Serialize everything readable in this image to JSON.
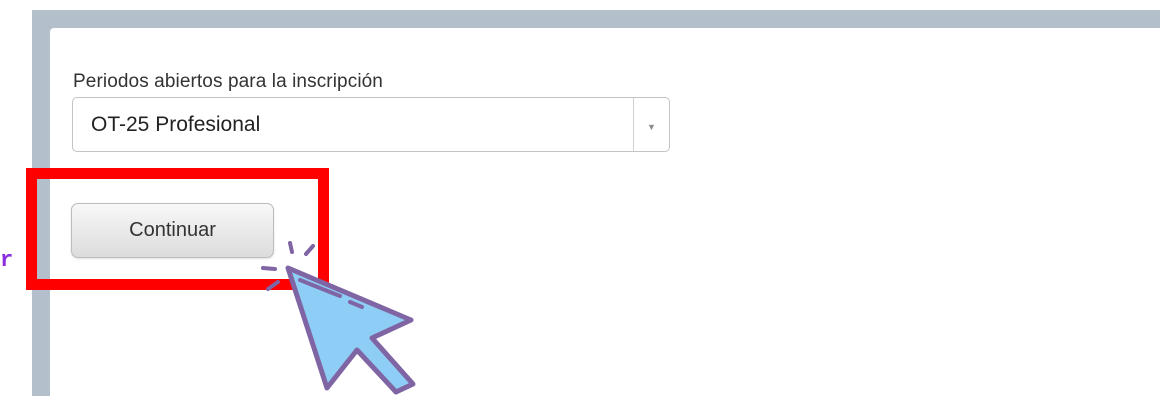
{
  "form": {
    "select_label": "Periodos abiertos para la inscripción",
    "selected_value": "OT-25 Profesional",
    "continue_label": "Continuar"
  },
  "side_text": "r",
  "icons": {
    "dropdown": "dropdown-arrow-icon",
    "cursor": "click-cursor-icon"
  },
  "colors": {
    "frame": "#b4bfcc",
    "highlight": "#ff0000",
    "cursor_fill": "#8ecdf5",
    "cursor_outline": "#7f65a3",
    "side_text": "#8b2be2"
  }
}
